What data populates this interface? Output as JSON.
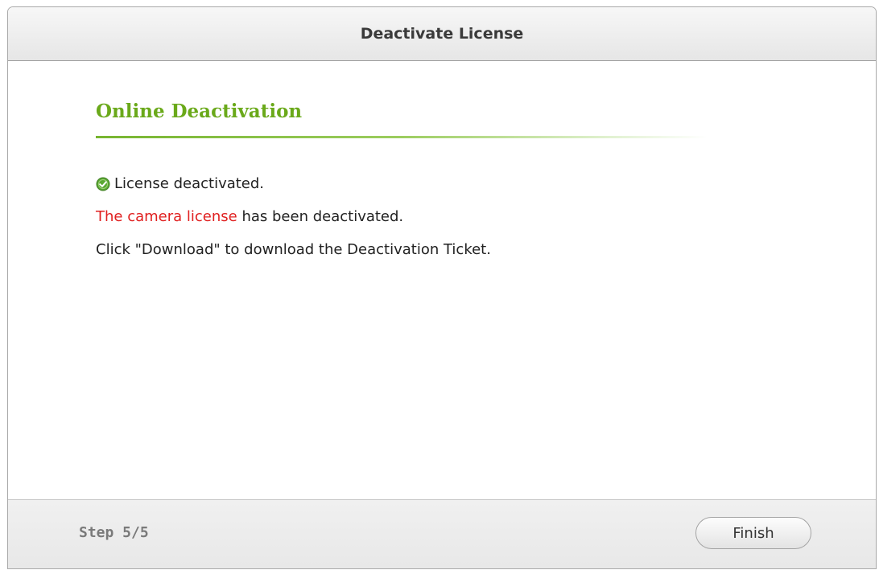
{
  "dialog": {
    "title": "Deactivate License"
  },
  "section": {
    "title": "Online Deactivation"
  },
  "messages": {
    "status_icon": "check-circle-icon",
    "status": "License deactivated.",
    "camera_license": "The camera license",
    "deactivated_suffix": "has been deactivated.",
    "download_hint": "Click \"Download\" to download the Deactivation Ticket."
  },
  "footer": {
    "step": "Step 5/5",
    "finish_label": "Finish"
  },
  "colors": {
    "section_title": "#6aa91a",
    "highlight_red": "#e02020",
    "success_icon": "#5aa832"
  }
}
